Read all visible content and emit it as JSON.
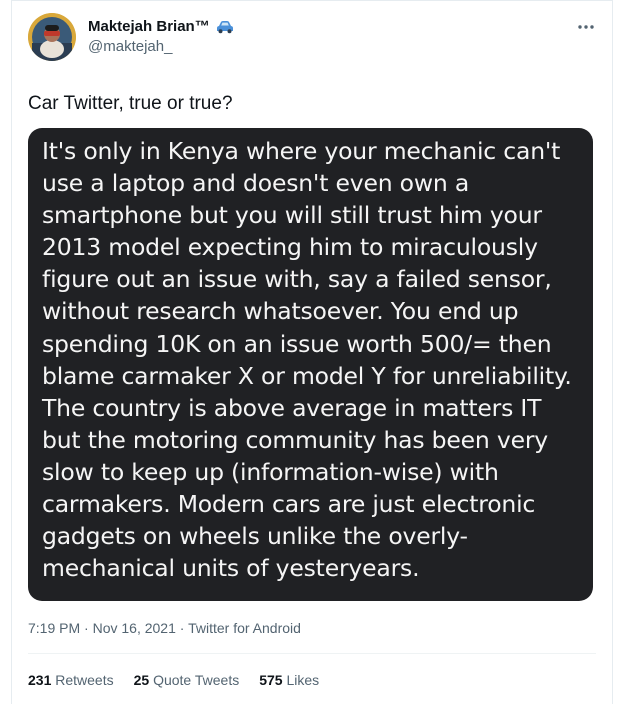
{
  "author": {
    "display_name": "Maktejah Brian™",
    "handle": "@maktejah_"
  },
  "tweet": {
    "text": "Car Twitter, true or true?",
    "image_text": "It's only in Kenya where your mechanic can't\nuse a laptop and doesn't even own a\nsmartphone but you will still trust him your\n2013 model expecting him to miraculously\nfigure out an issue with, say a failed sensor,\nwithout research whatsoever. You end up\nspending 10K on an issue worth 500/= then\nblame carmaker X or model Y for unreliability.\nThe country is above average in matters IT\nbut the motoring community has been very\nslow to keep up (information-wise) with\ncarmakers. Modern cars are just electronic\ngadgets on wheels unlike the overly-\nmechanical units of yesteryears.",
    "time": "7:19 PM",
    "separator": "·",
    "date": "Nov 16, 2021",
    "source": "Twitter for Android"
  },
  "stats": {
    "retweets_count": "231",
    "retweets_label": "Retweets",
    "quotes_count": "25",
    "quotes_label": "Quote Tweets",
    "likes_count": "575",
    "likes_label": "Likes"
  },
  "icons": {
    "more": "more-options-icon",
    "car": "car-emoji-icon"
  },
  "colors": {
    "text_primary": "#0f1419",
    "text_secondary": "#536471",
    "media_bg": "#202124",
    "car_blue": "#4a90d9"
  }
}
